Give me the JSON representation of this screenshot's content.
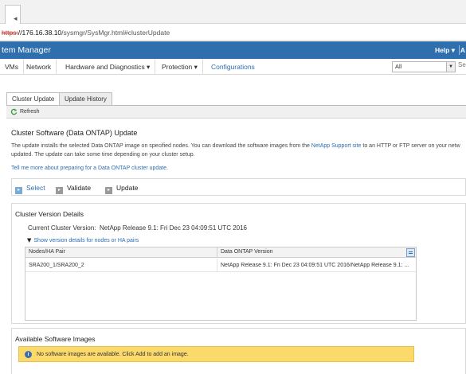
{
  "browser": {
    "tab_arrow": "◂",
    "url_proto": "https:",
    "url_host": "//176.16.38.10",
    "url_rest": "/sysmgr/SysMgr.html#clusterUpdate"
  },
  "header": {
    "title": "tem Manager",
    "help_label": "Help ▾",
    "trail": "A"
  },
  "nav": {
    "items": [
      "VMs",
      "Network",
      "Hardware and Diagnostics ▾",
      "Protection ▾",
      "Configurations"
    ],
    "active_index": 4,
    "filter_value": "All",
    "filter_arrow": "▼",
    "search_placeholder": "Sea"
  },
  "tabs": [
    {
      "label": "Cluster Update",
      "active": true
    },
    {
      "label": "Update History",
      "active": false
    }
  ],
  "toolbar": {
    "refresh_label": "Refresh"
  },
  "main": {
    "title": "Cluster Software (Data ONTAP) Update",
    "desc_line1_pre": "The update installs the selected Data ONTAP image on specified nodes. You can download the software images from the ",
    "desc_line1_link": "NetApp Support site",
    "desc_line1_post": " to an HTTP or FTP server on your netw",
    "desc_line2": "updated. The update can take some time depending on your cluster setup.",
    "learn_more_link": "Tell me more about preparing for a Data ONTAP cluster update."
  },
  "steps": [
    {
      "label": "Select",
      "active": true,
      "marker": "▸"
    },
    {
      "label": "Validate",
      "active": false,
      "marker": "▸"
    },
    {
      "label": "Update",
      "active": false,
      "marker": "▸"
    }
  ],
  "version_details": {
    "title": "Cluster Version Details",
    "current_label": "Current Cluster Version:",
    "current_value": "NetApp Release 9.1: Fri Dec 23 04:09:51 UTC 2016",
    "toggle_icon": "▼",
    "toggle_label": "Show version details for nodes or HA pairs",
    "grid": {
      "columns": [
        "Nodes/HA Pair",
        "Data ONTAP Version"
      ],
      "rows": [
        [
          "SRA200_1/SRA200_2",
          "NetApp Release 9.1: Fri Dec 23 04:09:51 UTC 2016/NetApp Release 9.1: ..."
        ]
      ]
    }
  },
  "available_images": {
    "title": "Available Software Images",
    "info_icon": "i",
    "warning_text": "No software images are available. Click Add to add an image."
  },
  "colors": {
    "header_blue": "#2f6fae",
    "link_blue": "#2d6db4",
    "warning_yellow": "#fbd96a"
  }
}
